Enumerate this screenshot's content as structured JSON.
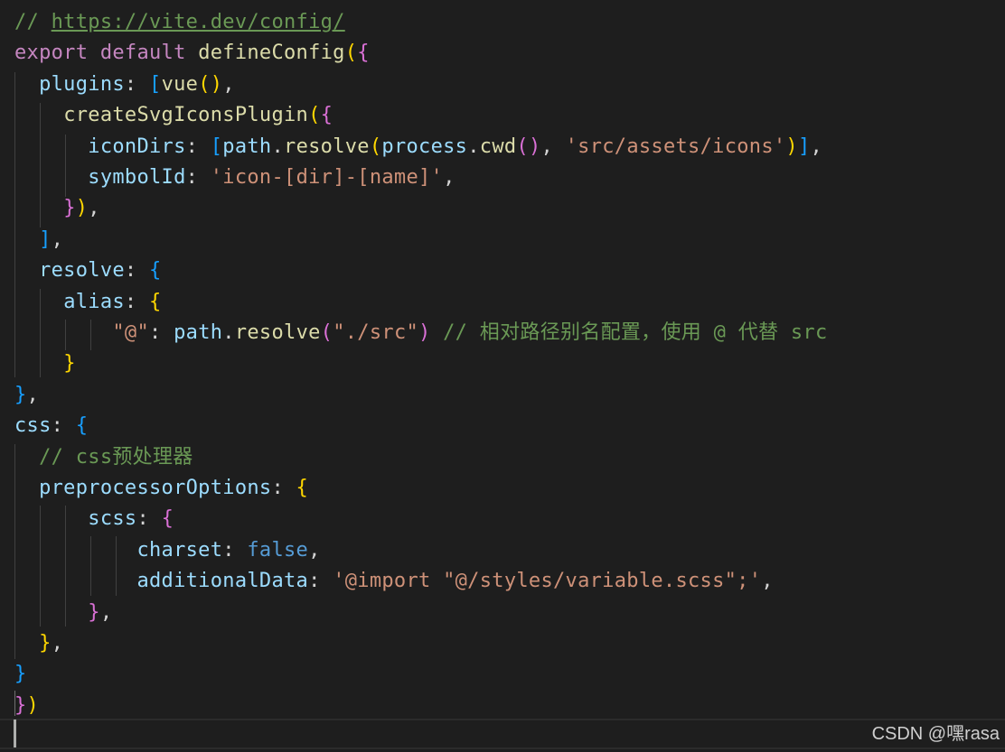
{
  "editor": {
    "language": "javascript",
    "lines": [
      [
        {
          "t": "// ",
          "c": "c-comment"
        },
        {
          "t": "https://vite.dev/config/",
          "c": "c-link"
        }
      ],
      [
        {
          "t": "export default ",
          "c": "c-keyword"
        },
        {
          "t": "defineConfig",
          "c": "c-func"
        },
        {
          "t": "(",
          "c": "b1"
        },
        {
          "t": "{",
          "c": "b2"
        }
      ],
      [
        {
          "t": "  ",
          "c": "c-punct"
        },
        {
          "t": "plugins",
          "c": "c-prop"
        },
        {
          "t": ": ",
          "c": "c-punct"
        },
        {
          "t": "[",
          "c": "b3"
        },
        {
          "t": "vue",
          "c": "c-func"
        },
        {
          "t": "()",
          "c": "b1"
        },
        {
          "t": ",",
          "c": "c-punct"
        }
      ],
      [
        {
          "t": "    ",
          "c": "c-punct"
        },
        {
          "t": "createSvgIconsPlugin",
          "c": "c-func"
        },
        {
          "t": "(",
          "c": "b1"
        },
        {
          "t": "{",
          "c": "b2"
        }
      ],
      [
        {
          "t": "      ",
          "c": "c-punct"
        },
        {
          "t": "iconDirs",
          "c": "c-prop"
        },
        {
          "t": ": ",
          "c": "c-punct"
        },
        {
          "t": "[",
          "c": "b3"
        },
        {
          "t": "path",
          "c": "c-var"
        },
        {
          "t": ".",
          "c": "c-punct"
        },
        {
          "t": "resolve",
          "c": "c-func"
        },
        {
          "t": "(",
          "c": "b1"
        },
        {
          "t": "process",
          "c": "c-var"
        },
        {
          "t": ".",
          "c": "c-punct"
        },
        {
          "t": "cwd",
          "c": "c-func"
        },
        {
          "t": "()",
          "c": "b2"
        },
        {
          "t": ", ",
          "c": "c-punct"
        },
        {
          "t": "'src/assets/icons'",
          "c": "c-string"
        },
        {
          "t": ")",
          "c": "b1"
        },
        {
          "t": "]",
          "c": "b3"
        },
        {
          "t": ",",
          "c": "c-punct"
        }
      ],
      [
        {
          "t": "      ",
          "c": "c-punct"
        },
        {
          "t": "symbolId",
          "c": "c-prop"
        },
        {
          "t": ": ",
          "c": "c-punct"
        },
        {
          "t": "'icon-[dir]-[name]'",
          "c": "c-string"
        },
        {
          "t": ",",
          "c": "c-punct"
        }
      ],
      [
        {
          "t": "    ",
          "c": "c-punct"
        },
        {
          "t": "}",
          "c": "b2"
        },
        {
          "t": ")",
          "c": "b1"
        },
        {
          "t": ",",
          "c": "c-punct"
        }
      ],
      [
        {
          "t": "  ",
          "c": "c-punct"
        },
        {
          "t": "]",
          "c": "b3"
        },
        {
          "t": ",",
          "c": "c-punct"
        }
      ],
      [
        {
          "t": "  ",
          "c": "c-punct"
        },
        {
          "t": "resolve",
          "c": "c-prop"
        },
        {
          "t": ": ",
          "c": "c-punct"
        },
        {
          "t": "{",
          "c": "b3"
        }
      ],
      [
        {
          "t": "    ",
          "c": "c-punct"
        },
        {
          "t": "alias",
          "c": "c-prop"
        },
        {
          "t": ": ",
          "c": "c-punct"
        },
        {
          "t": "{",
          "c": "b1"
        }
      ],
      [
        {
          "t": "        ",
          "c": "c-punct"
        },
        {
          "t": "\"@\"",
          "c": "c-string"
        },
        {
          "t": ": ",
          "c": "c-punct"
        },
        {
          "t": "path",
          "c": "c-var"
        },
        {
          "t": ".",
          "c": "c-punct"
        },
        {
          "t": "resolve",
          "c": "c-func"
        },
        {
          "t": "(",
          "c": "b2"
        },
        {
          "t": "\"./src\"",
          "c": "c-string"
        },
        {
          "t": ")",
          "c": "b2"
        },
        {
          "t": " // 相对路径别名配置，使用 @ 代替 src",
          "c": "c-comment"
        }
      ],
      [
        {
          "t": "    ",
          "c": "c-punct"
        },
        {
          "t": "}",
          "c": "b1"
        }
      ],
      [
        {
          "t": "}",
          "c": "b3"
        },
        {
          "t": ",",
          "c": "c-punct"
        }
      ],
      [
        {
          "t": "css",
          "c": "c-prop"
        },
        {
          "t": ": ",
          "c": "c-punct"
        },
        {
          "t": "{",
          "c": "b3"
        }
      ],
      [
        {
          "t": "  ",
          "c": "c-punct"
        },
        {
          "t": "// css预处理器",
          "c": "c-comment"
        }
      ],
      [
        {
          "t": "  ",
          "c": "c-punct"
        },
        {
          "t": "preprocessorOptions",
          "c": "c-prop"
        },
        {
          "t": ": ",
          "c": "c-punct"
        },
        {
          "t": "{",
          "c": "b1"
        }
      ],
      [
        {
          "t": "      ",
          "c": "c-punct"
        },
        {
          "t": "scss",
          "c": "c-prop"
        },
        {
          "t": ": ",
          "c": "c-punct"
        },
        {
          "t": "{",
          "c": "b2"
        }
      ],
      [
        {
          "t": "          ",
          "c": "c-punct"
        },
        {
          "t": "charset",
          "c": "c-prop"
        },
        {
          "t": ": ",
          "c": "c-punct"
        },
        {
          "t": "false",
          "c": "c-bool"
        },
        {
          "t": ",",
          "c": "c-punct"
        }
      ],
      [
        {
          "t": "          ",
          "c": "c-punct"
        },
        {
          "t": "additionalData",
          "c": "c-prop"
        },
        {
          "t": ": ",
          "c": "c-punct"
        },
        {
          "t": "'@import \"@/styles/variable.scss\";'",
          "c": "c-string"
        },
        {
          "t": ",",
          "c": "c-punct"
        }
      ],
      [
        {
          "t": "      ",
          "c": "c-punct"
        },
        {
          "t": "}",
          "c": "b2"
        },
        {
          "t": ",",
          "c": "c-punct"
        }
      ],
      [
        {
          "t": "  ",
          "c": "c-punct"
        },
        {
          "t": "}",
          "c": "b1"
        },
        {
          "t": ",",
          "c": "c-punct"
        }
      ],
      [
        {
          "t": "}",
          "c": "b3"
        }
      ],
      [
        {
          "t": "}",
          "c": "b2"
        },
        {
          "t": ")",
          "c": "b1"
        }
      ],
      []
    ]
  },
  "watermark": "CSDN @嘿rasa",
  "colors": {
    "background": "#1e1e1e",
    "comment": "#6a9955",
    "keyword": "#c586c0",
    "function": "#dcdcaa",
    "property": "#9cdcfe",
    "string": "#ce9178",
    "boolean": "#569cd6",
    "bracket_gold": "#ffd700",
    "bracket_orchid": "#da70d6",
    "bracket_blue": "#179fff"
  }
}
